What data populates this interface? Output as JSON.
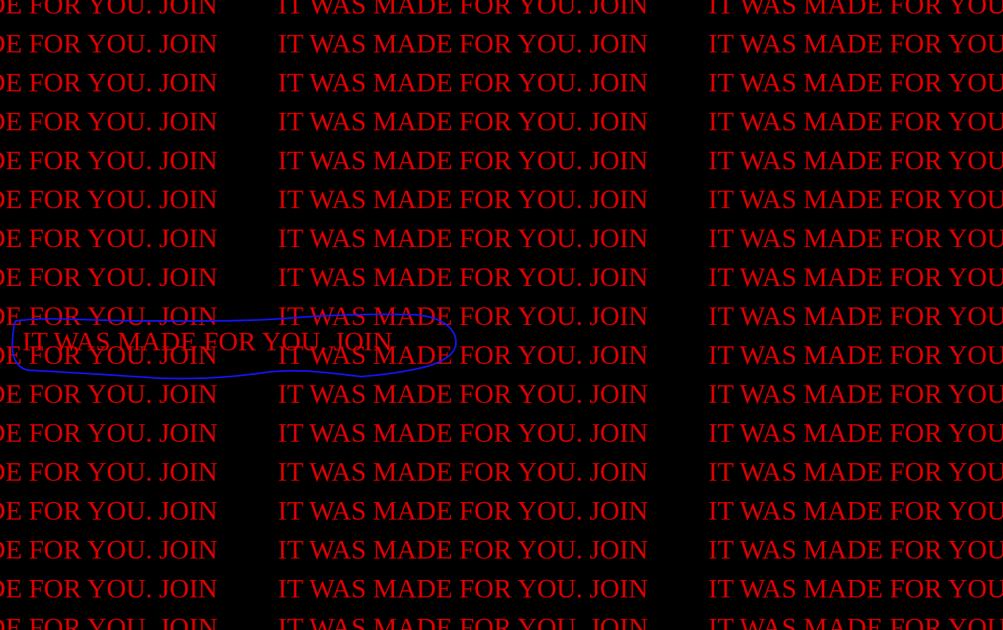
{
  "phrase": "IT WAS MADE FOR YOU. JOIN",
  "highlighted_phrase": "IT WAS MADE FOR YOU. JOIN",
  "colors": {
    "background": "#000000",
    "text": "#e00000",
    "outline": "#1515ff"
  }
}
